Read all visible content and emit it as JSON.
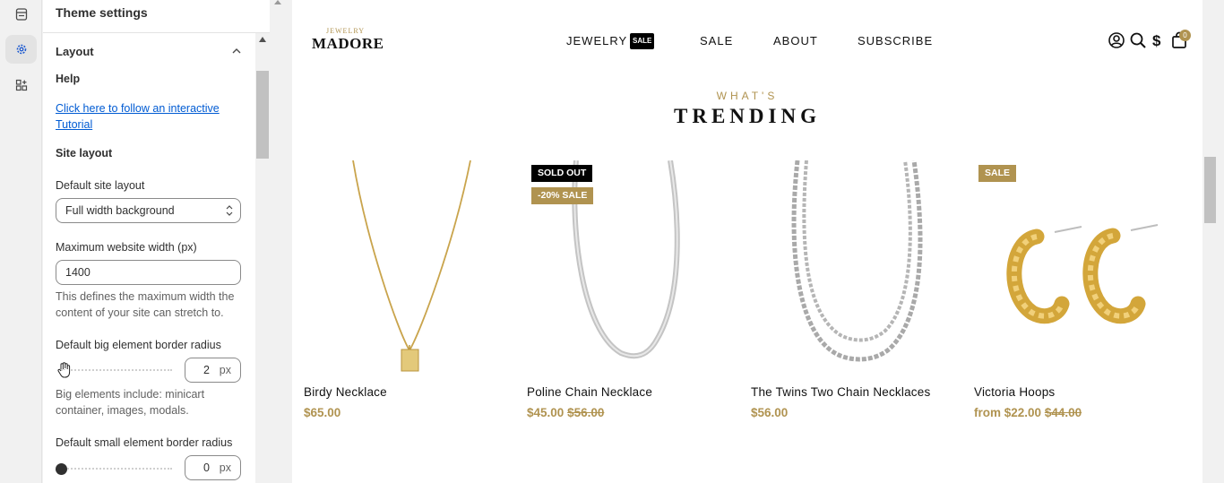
{
  "rail": {
    "items": [
      "apps-icon",
      "gear-icon",
      "blocks-icon"
    ]
  },
  "panel": {
    "title": "Theme settings",
    "section_title": "Layout",
    "help_heading": "Help",
    "help_link": "Click here to follow an interactive Tutorial",
    "site_layout_heading": "Site layout",
    "default_layout_label": "Default site layout",
    "default_layout_value": "Full width background",
    "max_width_label": "Maximum website width (px)",
    "max_width_value": "1400",
    "max_width_help": "This defines the maximum width the content of your site can stretch to.",
    "big_radius_label": "Default big element border radius",
    "big_radius_value": "2",
    "big_radius_unit": "px",
    "big_radius_help": "Big elements include: minicart container, images, modals.",
    "small_radius_label": "Default small element border radius",
    "small_radius_value": "0",
    "small_radius_unit": "px"
  },
  "store": {
    "logo_small": "JEWELRY",
    "logo_big": "MADORE",
    "nav": [
      "JEWELRY",
      "SALE",
      "ABOUT",
      "SUBSCRIBE"
    ],
    "nav_badge": "SALE",
    "cart_count": "0",
    "eyebrow": "WHAT'S",
    "heading": "TRENDING",
    "products": [
      {
        "title": "Birdy Necklace",
        "price": "$65.00",
        "old_price": "",
        "badges": []
      },
      {
        "title": "Poline Chain Necklace",
        "price": "$45.00",
        "old_price": "$56.00",
        "badges": [
          "SOLD OUT",
          "-20% SALE"
        ]
      },
      {
        "title": "The Twins Two Chain Necklaces",
        "price": "$56.00",
        "old_price": "",
        "badges": []
      },
      {
        "title": "Victoria Hoops",
        "price": "from $22.00",
        "old_price": "$44.00",
        "badges": [
          "SALE"
        ]
      }
    ]
  },
  "colors": {
    "accent_gold": "#b09350",
    "link_blue": "#005bd3"
  }
}
